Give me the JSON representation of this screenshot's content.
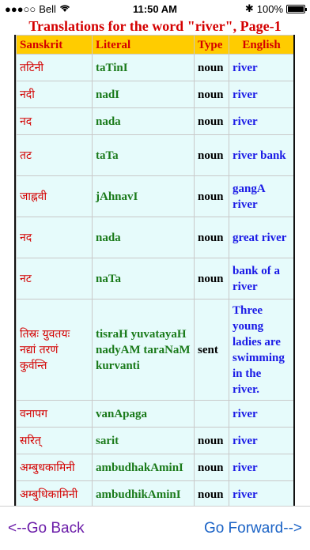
{
  "status_bar": {
    "carrier": "Bell",
    "time": "11:50 AM",
    "battery": "100%"
  },
  "title": "Translations for the word \"river\", Page-1",
  "table": {
    "headers": [
      "Sanskrit",
      "Literal",
      "Type",
      "English"
    ],
    "rows": [
      {
        "sanskrit": "तटिनी",
        "literal": "taTinI",
        "type": "noun",
        "english": "river"
      },
      {
        "sanskrit": "नदी",
        "literal": "nadI",
        "type": "noun",
        "english": "river"
      },
      {
        "sanskrit": "नद",
        "literal": "nada",
        "type": "noun",
        "english": "river"
      },
      {
        "sanskrit": "तट",
        "literal": "taTa",
        "type": "noun",
        "english": "river bank"
      },
      {
        "sanskrit": "जाह्नवी",
        "literal": "jAhnavI",
        "type": "noun",
        "english": "gangA river"
      },
      {
        "sanskrit": "नद",
        "literal": "nada",
        "type": "noun",
        "english": "great river"
      },
      {
        "sanskrit": "नट",
        "literal": "naTa",
        "type": "noun",
        "english": "bank of a river"
      },
      {
        "sanskrit": "तिस्रः युवतयः नद्यां तरणं कुर्वन्ति",
        "literal": "tisraH yuvatayaH nadyAM taraNaM kurvanti",
        "type": "sent",
        "english": "Three young ladies are swimming in the river."
      },
      {
        "sanskrit": "वनापग",
        "literal": "vanApaga",
        "type": "",
        "english": "river"
      },
      {
        "sanskrit": "सरित्",
        "literal": "sarit",
        "type": "noun",
        "english": "river"
      },
      {
        "sanskrit": "अम्बुधकामिनी",
        "literal": "ambudhakAminI",
        "type": "noun",
        "english": "river"
      },
      {
        "sanskrit": "अम्बुधिकामिनी",
        "literal": "ambudhikAminI",
        "type": "noun",
        "english": "river"
      }
    ]
  },
  "nav": {
    "back_label": "<--Go Back",
    "forward_label": "Go Forward-->"
  }
}
